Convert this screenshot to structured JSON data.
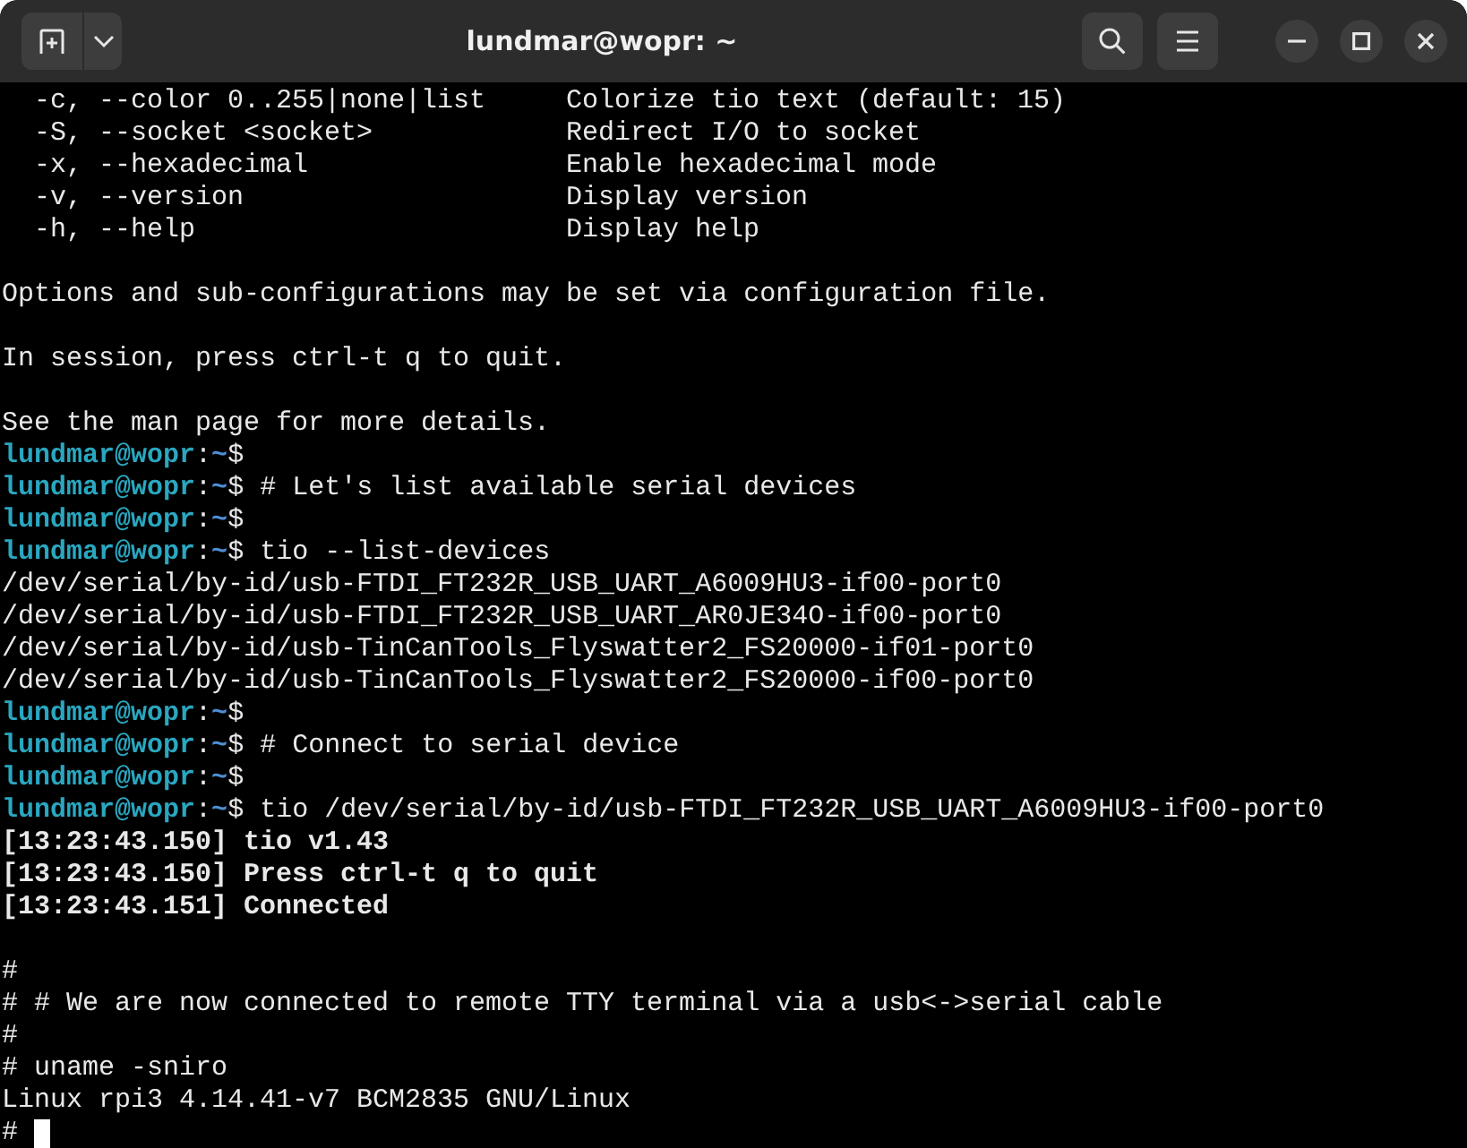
{
  "window": {
    "title": "lundmar@wopr: ~"
  },
  "terminal": {
    "lines": [
      {
        "kind": "option",
        "option": "-c, --color 0..255|none|list",
        "description": "Colorize tio text (default: 15)"
      },
      {
        "kind": "option",
        "option": "-S, --socket <socket>",
        "description": "Redirect I/O to socket"
      },
      {
        "kind": "option",
        "option": "-x, --hexadecimal",
        "description": "Enable hexadecimal mode"
      },
      {
        "kind": "option",
        "option": "-v, --version",
        "description": "Display version"
      },
      {
        "kind": "option",
        "option": "-h, --help",
        "description": "Display help"
      },
      {
        "kind": "blank"
      },
      {
        "kind": "text",
        "text": "Options and sub-configurations may be set via configuration file."
      },
      {
        "kind": "blank"
      },
      {
        "kind": "text",
        "text": "In session, press ctrl-t q to quit."
      },
      {
        "kind": "blank"
      },
      {
        "kind": "text",
        "text": "See the man page for more details."
      },
      {
        "kind": "prompt",
        "user": "lundmar@wopr",
        "sep": ":",
        "path": "~",
        "symbol": "$"
      },
      {
        "kind": "prompt",
        "user": "lundmar@wopr",
        "sep": ":",
        "path": "~",
        "symbol": "$",
        "command": "# Let's list available serial devices"
      },
      {
        "kind": "prompt",
        "user": "lundmar@wopr",
        "sep": ":",
        "path": "~",
        "symbol": "$"
      },
      {
        "kind": "prompt",
        "user": "lundmar@wopr",
        "sep": ":",
        "path": "~",
        "symbol": "$",
        "command": "tio --list-devices"
      },
      {
        "kind": "text",
        "text": "/dev/serial/by-id/usb-FTDI_FT232R_USB_UART_A6009HU3-if00-port0"
      },
      {
        "kind": "text",
        "text": "/dev/serial/by-id/usb-FTDI_FT232R_USB_UART_AR0JE34O-if00-port0"
      },
      {
        "kind": "text",
        "text": "/dev/serial/by-id/usb-TinCanTools_Flyswatter2_FS20000-if01-port0"
      },
      {
        "kind": "text",
        "text": "/dev/serial/by-id/usb-TinCanTools_Flyswatter2_FS20000-if00-port0"
      },
      {
        "kind": "prompt",
        "user": "lundmar@wopr",
        "sep": ":",
        "path": "~",
        "symbol": "$"
      },
      {
        "kind": "prompt",
        "user": "lundmar@wopr",
        "sep": ":",
        "path": "~",
        "symbol": "$",
        "command": "# Connect to serial device"
      },
      {
        "kind": "prompt",
        "user": "lundmar@wopr",
        "sep": ":",
        "path": "~",
        "symbol": "$"
      },
      {
        "kind": "prompt",
        "user": "lundmar@wopr",
        "sep": ":",
        "path": "~",
        "symbol": "$",
        "command": "tio /dev/serial/by-id/usb-FTDI_FT232R_USB_UART_A6009HU3-if00-port0"
      },
      {
        "kind": "bold",
        "text": "[13:23:43.150] tio v1.43"
      },
      {
        "kind": "bold",
        "text": "[13:23:43.150] Press ctrl-t q to quit"
      },
      {
        "kind": "bold",
        "text": "[13:23:43.151] Connected"
      },
      {
        "kind": "blank"
      },
      {
        "kind": "text",
        "text": "#"
      },
      {
        "kind": "text",
        "text": "# # We are now connected to remote TTY terminal via a usb<->serial cable"
      },
      {
        "kind": "text",
        "text": "#"
      },
      {
        "kind": "text",
        "text": "# uname -sniro"
      },
      {
        "kind": "text",
        "text": "Linux rpi3 4.14.41-v7 BCM2835 GNU/Linux"
      },
      {
        "kind": "cursor",
        "text": "#"
      }
    ]
  }
}
